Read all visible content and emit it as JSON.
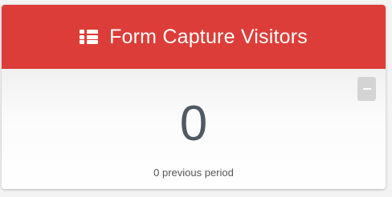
{
  "widget": {
    "title": "Form Capture Visitors",
    "header_icon": "list-icon",
    "accent_color": "#dd3d38",
    "value": "0",
    "previous_period_text": "0 previous period",
    "collapse_button": {
      "icon": "minus-icon",
      "label": "–"
    }
  }
}
